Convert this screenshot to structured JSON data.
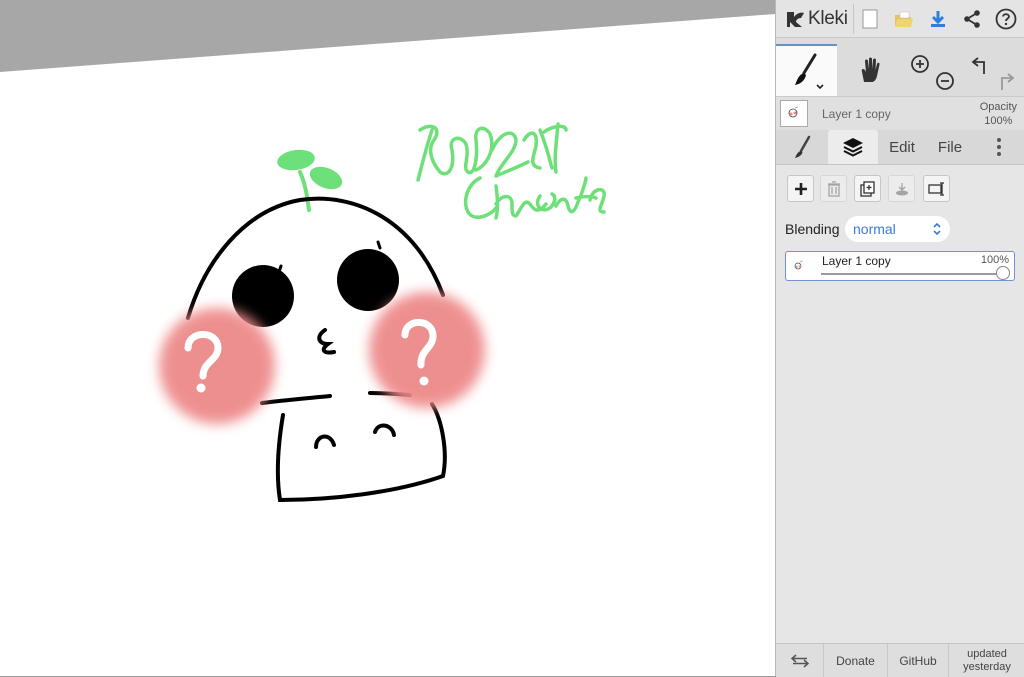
{
  "app": {
    "logo_text": "Kleki"
  },
  "toolbar_icons": [
    "new-image-icon",
    "open-folder-icon",
    "download-icon",
    "share-icon",
    "help-icon"
  ],
  "tools": [
    "brush-tool-icon",
    "hand-tool-icon",
    "zoom-in-icon",
    "zoom-out-icon",
    "undo-icon",
    "redo-icon"
  ],
  "layer_info": {
    "name": "Layer 1 copy",
    "opacity_label": "Opacity",
    "opacity_value": "100%"
  },
  "tabs": {
    "edit": "Edit",
    "file": "File"
  },
  "layers_panel": {
    "blending_label": "Blending",
    "blending_value": "normal",
    "layers": [
      {
        "name": "Layer 1 copy",
        "opacity": "100%",
        "opacity_fraction": 1.0
      }
    ]
  },
  "footer": {
    "donate": "Donate",
    "github": "GitHub",
    "updated_line1": "updated",
    "updated_line2": "yesterday"
  },
  "colors": {
    "accent": "#3a7bd5",
    "handwriting": "#6ee07a",
    "blush": "#ee8a8a",
    "download": "#2f7fd8"
  }
}
